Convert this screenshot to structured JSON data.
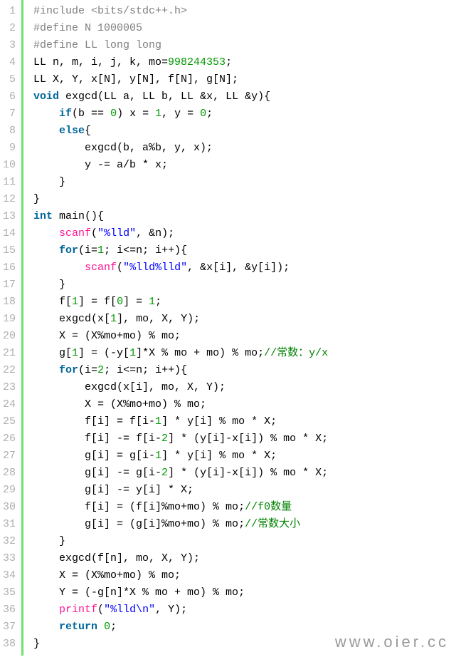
{
  "watermark": "www.oier.cc",
  "lines": [
    {
      "n": "1",
      "segs": [
        {
          "t": "#include <bits/stdc++.h>",
          "c": "pp"
        }
      ]
    },
    {
      "n": "2",
      "segs": [
        {
          "t": "#define N 1000005",
          "c": "pp"
        }
      ]
    },
    {
      "n": "3",
      "segs": [
        {
          "t": "#define LL long long",
          "c": "pp"
        }
      ]
    },
    {
      "n": "4",
      "segs": [
        {
          "t": "LL n, m, i, j, k, mo="
        },
        {
          "t": "998244353",
          "c": "num"
        },
        {
          "t": ";"
        }
      ]
    },
    {
      "n": "5",
      "segs": [
        {
          "t": "LL X, Y, x[N], y[N], f[N], g[N];"
        }
      ]
    },
    {
      "n": "6",
      "segs": [
        {
          "t": "void",
          "c": "kw"
        },
        {
          "t": " exgcd(LL a, LL b, LL &x, LL &y){"
        }
      ]
    },
    {
      "n": "7",
      "segs": [
        {
          "t": "    "
        },
        {
          "t": "if",
          "c": "kw"
        },
        {
          "t": "(b == "
        },
        {
          "t": "0",
          "c": "num"
        },
        {
          "t": ") x = "
        },
        {
          "t": "1",
          "c": "num"
        },
        {
          "t": ", y = "
        },
        {
          "t": "0",
          "c": "num"
        },
        {
          "t": ";"
        }
      ]
    },
    {
      "n": "8",
      "segs": [
        {
          "t": "    "
        },
        {
          "t": "else",
          "c": "kw"
        },
        {
          "t": "{"
        }
      ]
    },
    {
      "n": "9",
      "segs": [
        {
          "t": "        exgcd(b, a%b, y, x);"
        }
      ]
    },
    {
      "n": "10",
      "segs": [
        {
          "t": "        y -= a/b * x;"
        }
      ]
    },
    {
      "n": "11",
      "segs": [
        {
          "t": "    }"
        }
      ]
    },
    {
      "n": "12",
      "segs": [
        {
          "t": "}"
        }
      ]
    },
    {
      "n": "13",
      "segs": [
        {
          "t": "int",
          "c": "kw"
        },
        {
          "t": " main(){"
        }
      ]
    },
    {
      "n": "14",
      "segs": [
        {
          "t": "    "
        },
        {
          "t": "scanf",
          "c": "fn"
        },
        {
          "t": "("
        },
        {
          "t": "\"%lld\"",
          "c": "str"
        },
        {
          "t": ", &n);"
        }
      ]
    },
    {
      "n": "15",
      "segs": [
        {
          "t": "    "
        },
        {
          "t": "for",
          "c": "kw"
        },
        {
          "t": "(i="
        },
        {
          "t": "1",
          "c": "num"
        },
        {
          "t": "; i<=n; i++){"
        }
      ]
    },
    {
      "n": "16",
      "segs": [
        {
          "t": "        "
        },
        {
          "t": "scanf",
          "c": "fn"
        },
        {
          "t": "("
        },
        {
          "t": "\"%lld%lld\"",
          "c": "str"
        },
        {
          "t": ", &x[i], &y[i]);"
        }
      ]
    },
    {
      "n": "17",
      "segs": [
        {
          "t": "    }"
        }
      ]
    },
    {
      "n": "18",
      "segs": [
        {
          "t": "    f["
        },
        {
          "t": "1",
          "c": "num"
        },
        {
          "t": "] = f["
        },
        {
          "t": "0",
          "c": "num"
        },
        {
          "t": "] = "
        },
        {
          "t": "1",
          "c": "num"
        },
        {
          "t": ";"
        }
      ]
    },
    {
      "n": "19",
      "segs": [
        {
          "t": "    exgcd(x["
        },
        {
          "t": "1",
          "c": "num"
        },
        {
          "t": "], mo, X, Y);"
        }
      ]
    },
    {
      "n": "20",
      "segs": [
        {
          "t": "    X = (X%mo+mo) % mo;"
        }
      ]
    },
    {
      "n": "21",
      "segs": [
        {
          "t": "    g["
        },
        {
          "t": "1",
          "c": "num"
        },
        {
          "t": "] = (-y["
        },
        {
          "t": "1",
          "c": "num"
        },
        {
          "t": "]*X % mo + mo) % mo;"
        },
        {
          "t": "//常数：y/x",
          "c": "cmt"
        }
      ]
    },
    {
      "n": "22",
      "segs": [
        {
          "t": "    "
        },
        {
          "t": "for",
          "c": "kw"
        },
        {
          "t": "(i="
        },
        {
          "t": "2",
          "c": "num"
        },
        {
          "t": "; i<=n; i++){"
        }
      ]
    },
    {
      "n": "23",
      "segs": [
        {
          "t": "        exgcd(x[i], mo, X, Y);"
        }
      ]
    },
    {
      "n": "24",
      "segs": [
        {
          "t": "        X = (X%mo+mo) % mo;"
        }
      ]
    },
    {
      "n": "25",
      "segs": [
        {
          "t": "        f[i] = f[i-"
        },
        {
          "t": "1",
          "c": "num"
        },
        {
          "t": "] * y[i] % mo * X;"
        }
      ]
    },
    {
      "n": "26",
      "segs": [
        {
          "t": "        f[i] -= f[i-"
        },
        {
          "t": "2",
          "c": "num"
        },
        {
          "t": "] * (y[i]-x[i]) % mo * X;"
        }
      ]
    },
    {
      "n": "27",
      "segs": [
        {
          "t": "        g[i] = g[i-"
        },
        {
          "t": "1",
          "c": "num"
        },
        {
          "t": "] * y[i] % mo * X;"
        }
      ]
    },
    {
      "n": "28",
      "segs": [
        {
          "t": "        g[i] -= g[i-"
        },
        {
          "t": "2",
          "c": "num"
        },
        {
          "t": "] * (y[i]-x[i]) % mo * X;"
        }
      ]
    },
    {
      "n": "29",
      "segs": [
        {
          "t": "        g[i] -= y[i] * X;"
        }
      ]
    },
    {
      "n": "30",
      "segs": [
        {
          "t": "        f[i] = (f[i]%mo+mo) % mo;"
        },
        {
          "t": "//f0数量",
          "c": "cmt"
        }
      ]
    },
    {
      "n": "31",
      "segs": [
        {
          "t": "        g[i] = (g[i]%mo+mo) % mo;"
        },
        {
          "t": "//常数大小",
          "c": "cmt"
        }
      ]
    },
    {
      "n": "32",
      "segs": [
        {
          "t": "    }"
        }
      ]
    },
    {
      "n": "33",
      "segs": [
        {
          "t": "    exgcd(f[n], mo, X, Y);"
        }
      ]
    },
    {
      "n": "34",
      "segs": [
        {
          "t": "    X = (X%mo+mo) % mo;"
        }
      ]
    },
    {
      "n": "35",
      "segs": [
        {
          "t": "    Y = (-g[n]*X % mo + mo) % mo;"
        }
      ]
    },
    {
      "n": "36",
      "segs": [
        {
          "t": "    "
        },
        {
          "t": "printf",
          "c": "fn"
        },
        {
          "t": "("
        },
        {
          "t": "\"%lld\\n\"",
          "c": "str"
        },
        {
          "t": ", Y);"
        }
      ]
    },
    {
      "n": "37",
      "segs": [
        {
          "t": "    "
        },
        {
          "t": "return",
          "c": "kw"
        },
        {
          "t": " "
        },
        {
          "t": "0",
          "c": "num"
        },
        {
          "t": ";"
        }
      ]
    },
    {
      "n": "38",
      "segs": [
        {
          "t": "}"
        }
      ]
    }
  ]
}
